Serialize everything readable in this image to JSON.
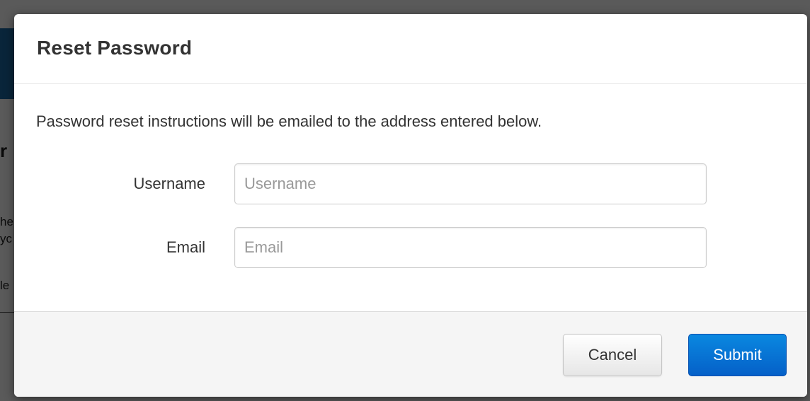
{
  "modal": {
    "title": "Reset Password",
    "intro": "Password reset instructions will be emailed to the address entered below."
  },
  "form": {
    "username": {
      "label": "Username",
      "placeholder": "Username",
      "value": ""
    },
    "email": {
      "label": "Email",
      "placeholder": "Email",
      "value": ""
    }
  },
  "footer": {
    "cancel_label": "Cancel",
    "submit_label": "Submit"
  },
  "background_fragments": [
    "r",
    "he",
    "yc",
    "le"
  ],
  "colors": {
    "primary_button": "#0560c8",
    "footer_background": "#f5f5f5",
    "text": "#333333",
    "placeholder": "#999999"
  }
}
